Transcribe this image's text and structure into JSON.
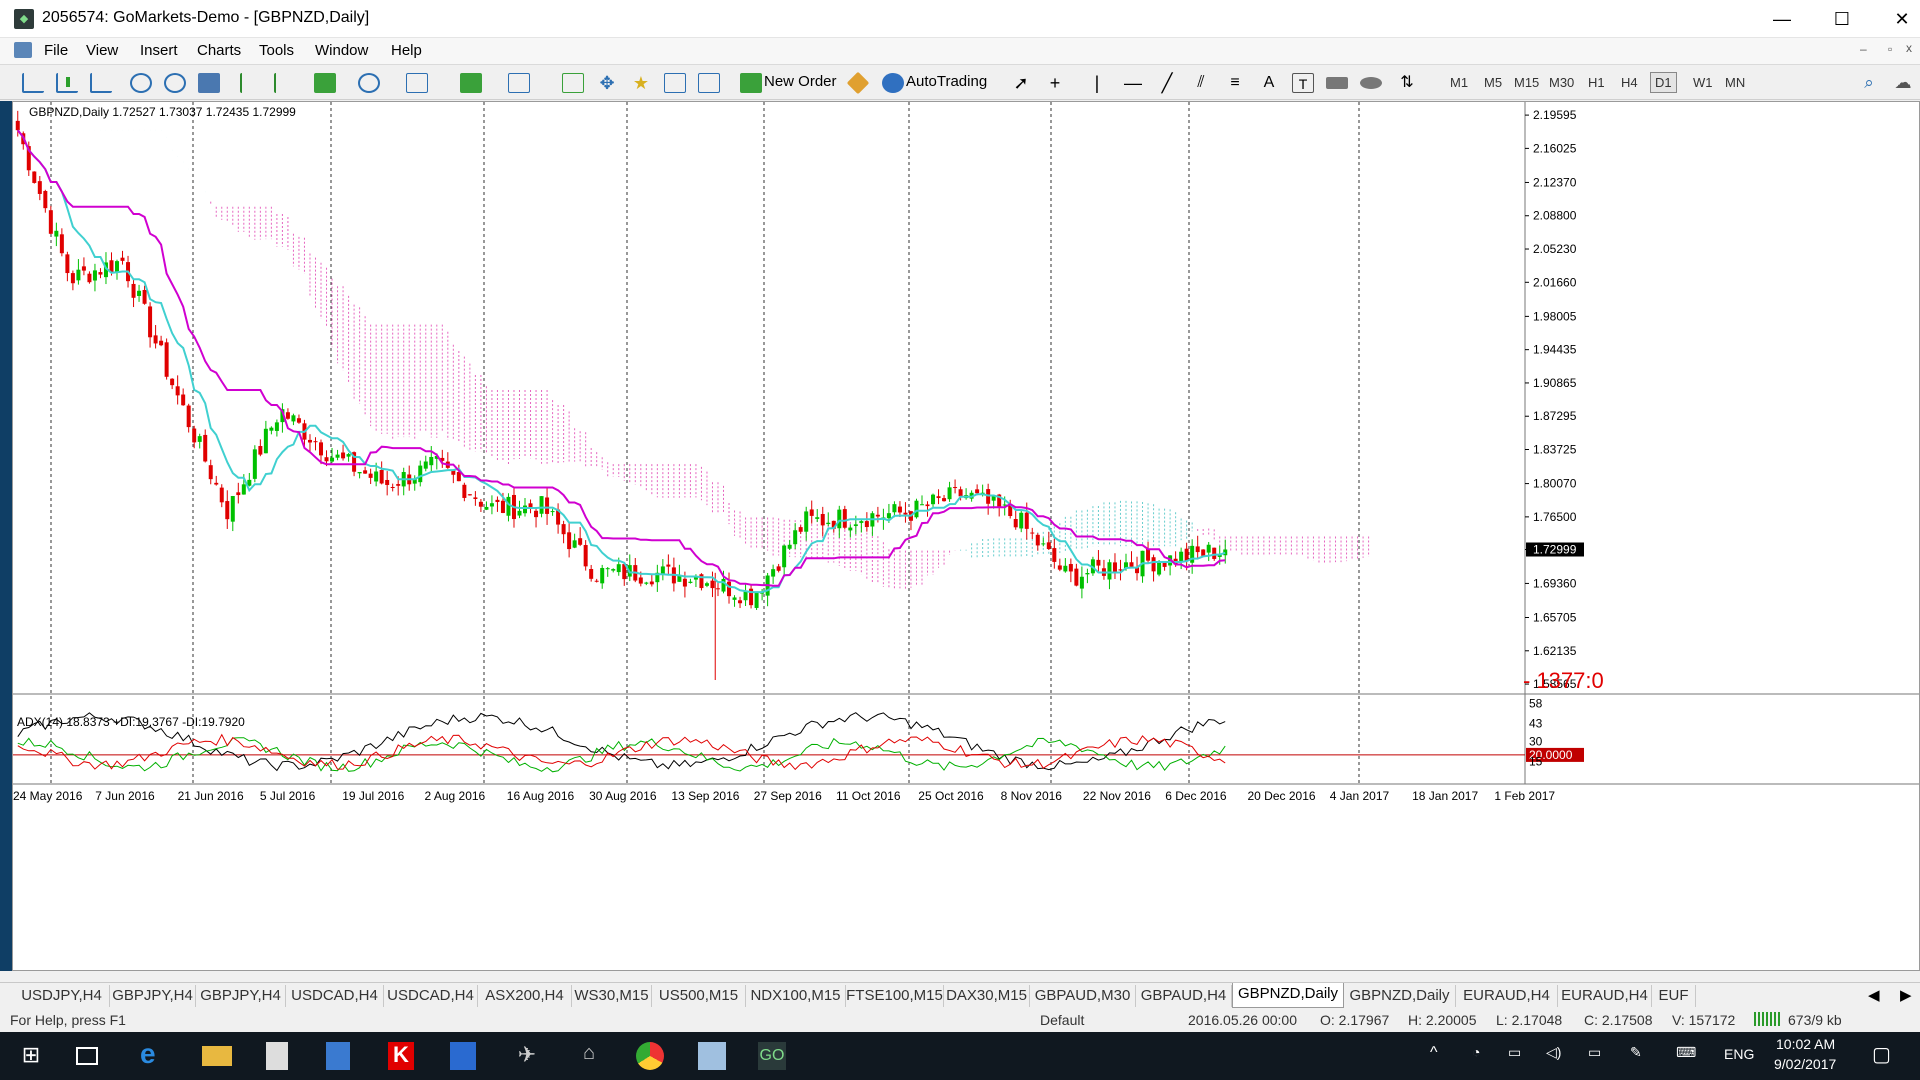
{
  "window": {
    "title": "2056574: GoMarkets-Demo - [GBPNZD,Daily]",
    "app_icon": "metatrader-icon"
  },
  "menu": [
    "File",
    "View",
    "Insert",
    "Charts",
    "Tools",
    "Window",
    "Help"
  ],
  "toolbar": {
    "new_order": "New Order",
    "autotrading": "AutoTrading",
    "timeframes": [
      "M1",
      "M5",
      "M15",
      "M30",
      "H1",
      "H4",
      "D1",
      "W1",
      "MN"
    ],
    "active_timeframe": "D1"
  },
  "chart": {
    "header": "GBPNZD,Daily  1.72527 1.73037 1.72435 1.72999",
    "current_price": "1.72999",
    "annotation": "1377:0",
    "y_ticks": [
      "2.19595",
      "2.16025",
      "2.12370",
      "2.08800",
      "2.05230",
      "2.01660",
      "1.98005",
      "1.94435",
      "1.90865",
      "1.87295",
      "1.83725",
      "1.80070",
      "1.76500",
      "1.72999",
      "1.69360",
      "1.65705",
      "1.62135",
      "1.58565"
    ],
    "x_ticks": [
      "24 May 2016",
      "7 Jun 2016",
      "21 Jun 2016",
      "5 Jul 2016",
      "19 Jul 2016",
      "2 Aug 2016",
      "16 Aug 2016",
      "30 Aug 2016",
      "13 Sep 2016",
      "27 Sep 2016",
      "11 Oct 2016",
      "25 Oct 2016",
      "8 Nov 2016",
      "22 Nov 2016",
      "6 Dec 2016",
      "20 Dec 2016",
      "4 Jan 2017",
      "18 Jan 2017",
      "1 Feb 2017"
    ],
    "indicator_header": "ADX(14) 18.8373 +DI:19.3767 -DI:19.7920",
    "indicator_ticks": [
      "58",
      "43",
      "30",
      "20.0000",
      "15"
    ],
    "colors": {
      "bull": "#00c000",
      "bear": "#e00000",
      "kijun": "#d000d0",
      "tenkan": "#40d0d0",
      "cloud_pink": "#e040b0",
      "cloud_teal": "#40c0c0",
      "adx": "#000000",
      "plus_di": "#00b000",
      "minus_di": "#e00000"
    }
  },
  "chart_data": {
    "type": "candlestick",
    "symbol": "GBPNZD",
    "timeframe": "Daily",
    "last": {
      "open": 1.72527,
      "high": 1.73037,
      "low": 1.72435,
      "close": 1.72999
    },
    "close_approx": [
      [
        "24 May 2016",
        2.18
      ],
      [
        "7 Jun 2016",
        2.02
      ],
      [
        "21 Jun 2016",
        2.04
      ],
      [
        "24 Jun 2016",
        1.9
      ],
      [
        "5 Jul 2016",
        1.77
      ],
      [
        "19 Jul 2016",
        1.88
      ],
      [
        "2 Aug 2016",
        1.83
      ],
      [
        "16 Aug 2016",
        1.8
      ],
      [
        "30 Aug 2016",
        1.82
      ],
      [
        "13 Sep 2016",
        1.775
      ],
      [
        "27 Sep 2016",
        1.775
      ],
      [
        "7 Oct 2016",
        1.705
      ],
      [
        "11 Oct 2016",
        1.705
      ],
      [
        "25 Oct 2016",
        1.7
      ],
      [
        "8 Nov 2016",
        1.68
      ],
      [
        "10 Nov 2016",
        1.76
      ],
      [
        "22 Nov 2016",
        1.765
      ],
      [
        "6 Dec 2016",
        1.77
      ],
      [
        "20 Dec 2016",
        1.79
      ],
      [
        "4 Jan 2017",
        1.765
      ],
      [
        "11 Jan 2017",
        1.7
      ],
      [
        "18 Jan 2017",
        1.715
      ],
      [
        "1 Feb 2017",
        1.72
      ],
      [
        "9 Feb 2017",
        1.72999
      ]
    ],
    "indicators": [
      "Ichimoku Kinko Hyo",
      "ADX(14)"
    ],
    "adx": {
      "adx": 18.8373,
      "plus_di": 19.3767,
      "minus_di": 19.792,
      "level": 20.0
    }
  },
  "tabs": [
    "USDJPY,H4",
    "GBPJPY,H4",
    "GBPJPY,H4",
    "USDCAD,H4",
    "USDCAD,H4",
    "ASX200,H4",
    "WS30,M15",
    "US500,M15",
    "NDX100,M15",
    "FTSE100,M15",
    "DAX30,M15",
    "GBPAUD,M30",
    "GBPAUD,H4",
    "GBPNZD,Daily",
    "GBPNZD,Daily",
    "EURAUD,H4",
    "EURAUD,H4",
    "EUF"
  ],
  "active_tab_index": 13,
  "status": {
    "help": "For Help, press F1",
    "profile": "Default",
    "datetime": "2016.05.26 00:00",
    "open": "O: 2.17967",
    "high": "H: 2.20005",
    "low": "L: 2.17048",
    "close": "C: 2.17508",
    "volume": "V: 157172",
    "traffic": "673/9 kb"
  },
  "taskbar": {
    "lang": "ENG",
    "time": "10:02 AM",
    "date": "9/02/2017"
  }
}
